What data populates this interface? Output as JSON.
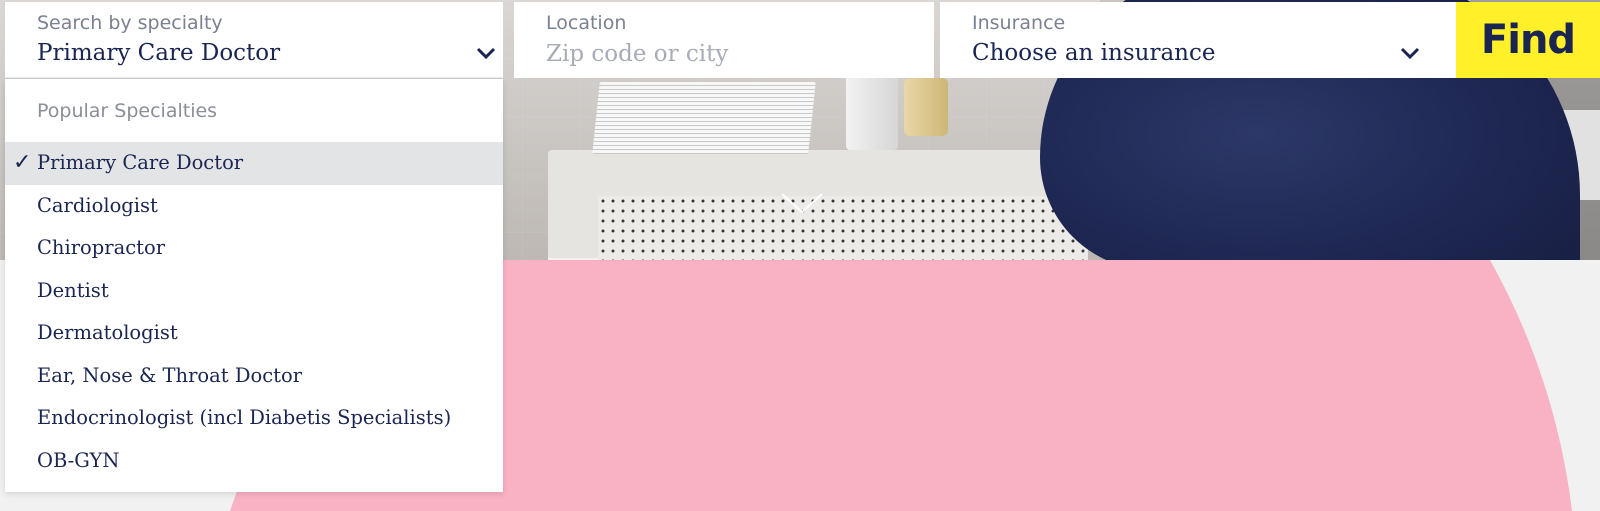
{
  "search": {
    "specialty": {
      "label": "Search by specialty",
      "selected": "Primary Care Doctor"
    },
    "location": {
      "label": "Location",
      "placeholder": "Zip code or city",
      "value": ""
    },
    "insurance": {
      "label": "Insurance",
      "selected": "Choose an insurance"
    },
    "find_label": "Find"
  },
  "dropdown": {
    "group_title": "Popular Specialties",
    "options": [
      {
        "label": "Primary Care Doctor",
        "selected": true
      },
      {
        "label": "Cardiologist",
        "selected": false
      },
      {
        "label": "Chiropractor",
        "selected": false
      },
      {
        "label": "Dentist",
        "selected": false
      },
      {
        "label": "Dermatologist",
        "selected": false
      },
      {
        "label": "Ear, Nose & Throat Doctor",
        "selected": false
      },
      {
        "label": "Endocrinologist (incl Diabetis Specialists)",
        "selected": false
      },
      {
        "label": "OB-GYN",
        "selected": false
      }
    ],
    "check_glyph": "✓"
  },
  "icons": {
    "specialty_chevron": "chevron-down-icon",
    "insurance_chevron": "chevron-down-icon",
    "scroll_chevron": "scroll-down-chevron-icon"
  },
  "colors": {
    "brand_navy": "#1a2551",
    "find_yellow": "#fff02a",
    "pink_shape": "#f9b2c4",
    "page_background": "#f1f1f1",
    "selected_row": "#e3e4e6"
  }
}
